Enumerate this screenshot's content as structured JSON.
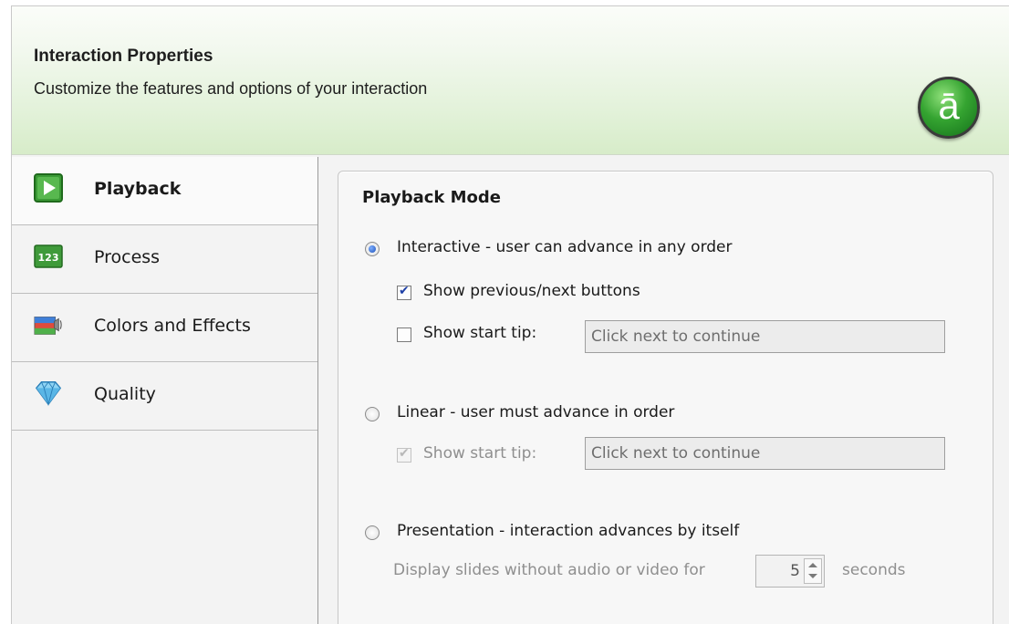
{
  "header": {
    "title": "Interaction Properties",
    "subtitle": "Customize the features and options of your interaction",
    "logo_letter": "ā"
  },
  "sidebar": {
    "items": [
      {
        "label": "Playback",
        "icon": "play-icon",
        "active": true
      },
      {
        "label": "Process",
        "icon": "numbers-icon",
        "active": false
      },
      {
        "label": "Colors and Effects",
        "icon": "colors-effects-icon",
        "active": false
      },
      {
        "label": "Quality",
        "icon": "diamond-icon",
        "active": false
      }
    ]
  },
  "panel": {
    "title": "Playback Mode",
    "interactive": {
      "label": "Interactive - user can advance in any order",
      "selected": true,
      "show_prev_next_label": "Show previous/next buttons",
      "show_prev_next_checked": true,
      "show_start_tip_label": "Show start tip:",
      "show_start_tip_checked": false,
      "start_tip_placeholder": "Click next to continue"
    },
    "linear": {
      "label": "Linear - user must advance in order",
      "selected": false,
      "show_start_tip_label": "Show start tip:",
      "show_start_tip_checked": true,
      "start_tip_placeholder": "Click next to continue"
    },
    "presentation": {
      "label": "Presentation - interaction advances by itself",
      "selected": false,
      "display_label": "Display slides without audio or video for",
      "seconds_value": "5",
      "seconds_label": "seconds"
    }
  },
  "colors": {
    "header_gradient_end": "#d7ecc9",
    "accent_green": "#35a431",
    "radio_blue": "#1b4fb8"
  }
}
